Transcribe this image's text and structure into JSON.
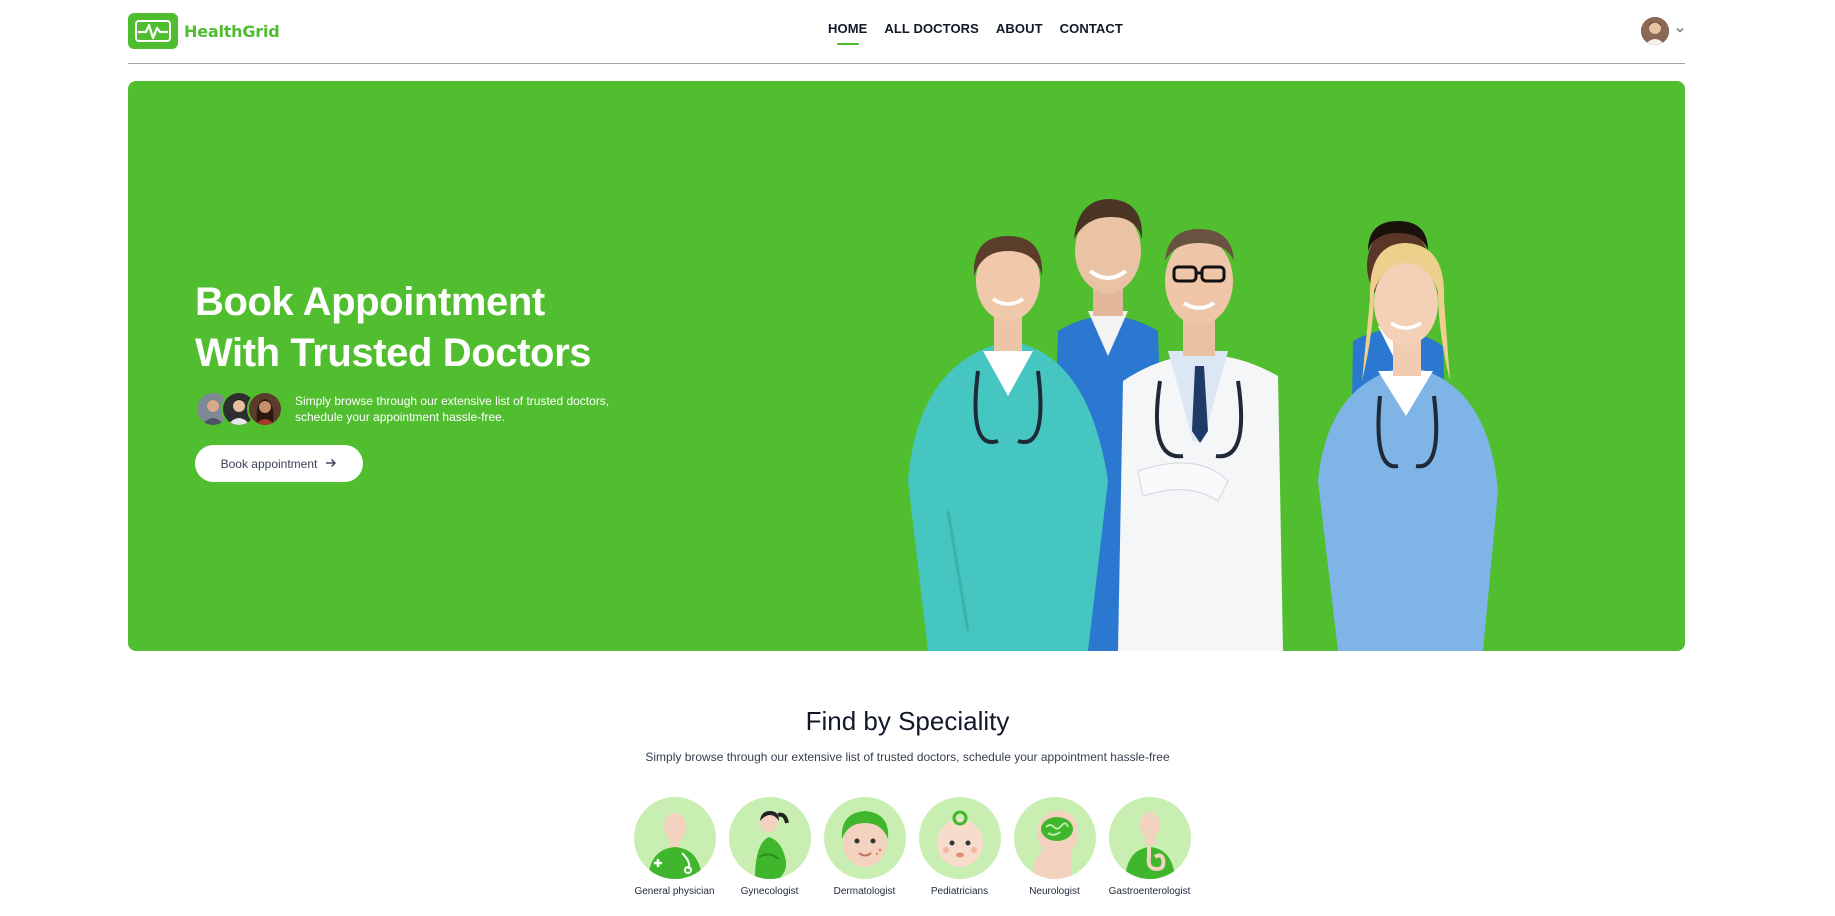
{
  "brand": {
    "name": "HealthGrid",
    "icon": "heartbeat-clipboard-icon",
    "color": "#4fbd2f"
  },
  "nav": {
    "items": [
      {
        "label": "HOME",
        "active": true
      },
      {
        "label": "ALL DOCTORS",
        "active": false
      },
      {
        "label": "ABOUT",
        "active": false
      },
      {
        "label": "CONTACT",
        "active": false
      }
    ],
    "profile_icon": "user-avatar",
    "dropdown_icon": "chevron-down-icon"
  },
  "hero": {
    "background": "#51be30",
    "title_line1": "Book Appointment",
    "title_line2": "With Trusted Doctors",
    "desc_line1": "Simply browse through our extensive list of trusted doctors,",
    "desc_line2": "schedule your appointment hassle-free.",
    "cta_label": "Book appointment",
    "cta_icon": "arrow-right-icon"
  },
  "speciality": {
    "title": "Find by Speciality",
    "subtitle": "Simply browse through our extensive list of trusted doctors, schedule your appointment hassle-free",
    "items": [
      {
        "label": "General physician",
        "icon": "doctor-stethoscope-icon"
      },
      {
        "label": "Gynecologist",
        "icon": "pregnant-woman-icon"
      },
      {
        "label": "Dermatologist",
        "icon": "face-skin-icon"
      },
      {
        "label": "Pediatricians",
        "icon": "baby-face-icon"
      },
      {
        "label": "Neurologist",
        "icon": "brain-head-icon"
      },
      {
        "label": "Gastroenterologist",
        "icon": "stomach-icon"
      }
    ]
  }
}
